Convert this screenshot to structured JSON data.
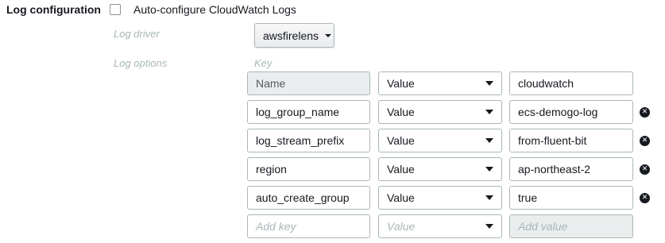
{
  "section_title": "Log configuration",
  "auto_configure": {
    "label": "Auto-configure CloudWatch Logs",
    "checked": false
  },
  "log_driver": {
    "label": "Log driver",
    "value": "awsfirelens"
  },
  "log_options": {
    "label": "Log options",
    "key_header": "Key",
    "rows": [
      {
        "key": "Name",
        "type": "Value",
        "value": "cloudwatch",
        "removable": false
      },
      {
        "key": "log_group_name",
        "type": "Value",
        "value": "ecs-demogo-log",
        "removable": true
      },
      {
        "key": "log_stream_prefix",
        "type": "Value",
        "value": "from-fluent-bit",
        "removable": true
      },
      {
        "key": "region",
        "type": "Value",
        "value": "ap-northeast-2",
        "removable": true
      },
      {
        "key": "auto_create_group",
        "type": "Value",
        "value": "true",
        "removable": true
      }
    ],
    "new_row": {
      "key_placeholder": "Add key",
      "type_placeholder": "Value",
      "value_placeholder": "Add value"
    }
  },
  "icons": {
    "remove": "close-circle-icon",
    "dropdown": "caret-down-icon"
  }
}
